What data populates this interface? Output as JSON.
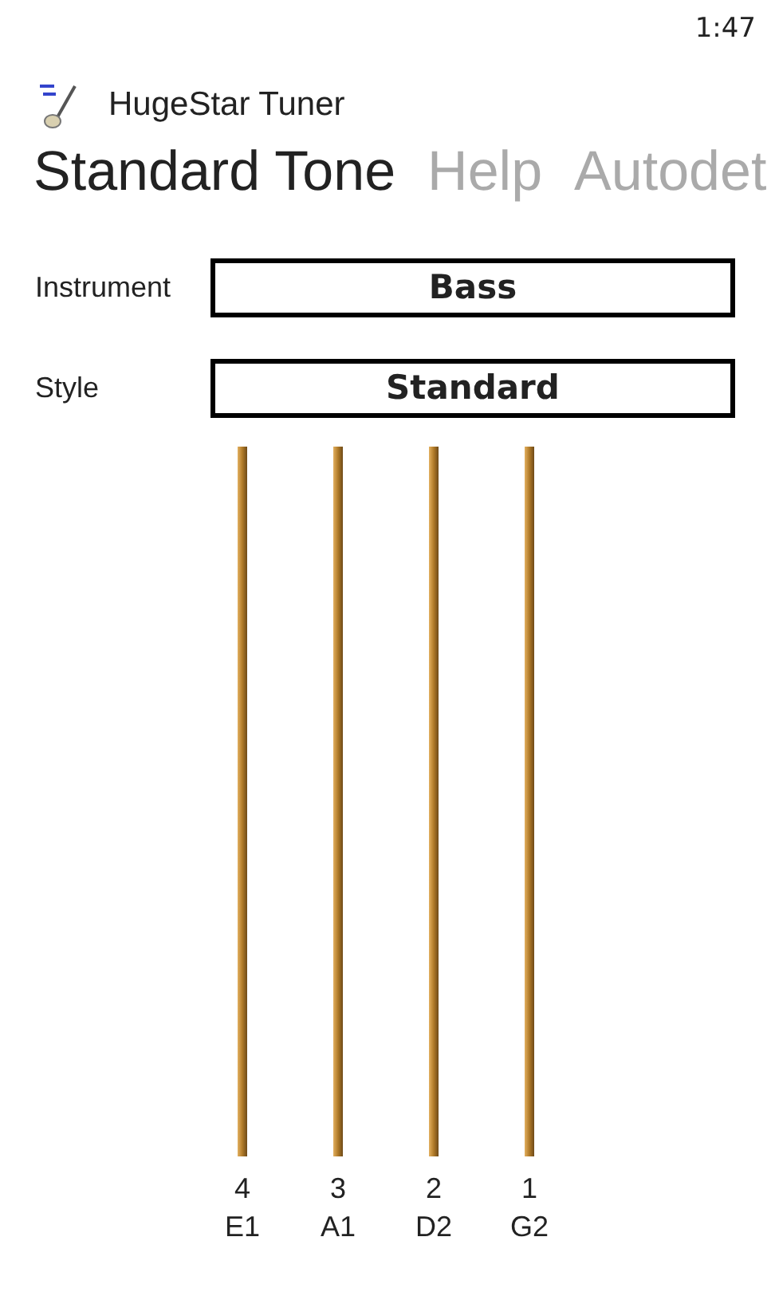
{
  "status_bar": {
    "time": "1:47"
  },
  "app": {
    "title": "HugeStar Tuner"
  },
  "tabs": [
    {
      "label": "Standard Tone",
      "selected": true
    },
    {
      "label": "Help",
      "selected": false
    },
    {
      "label": "Autodet",
      "selected": false
    }
  ],
  "fields": [
    {
      "label": "Instrument",
      "value": "Bass"
    },
    {
      "label": "Style",
      "value": "Standard"
    }
  ],
  "strings": [
    {
      "number": "4",
      "note": "E1"
    },
    {
      "number": "3",
      "note": "A1"
    },
    {
      "number": "2",
      "note": "D2"
    },
    {
      "number": "1",
      "note": "G2"
    }
  ]
}
